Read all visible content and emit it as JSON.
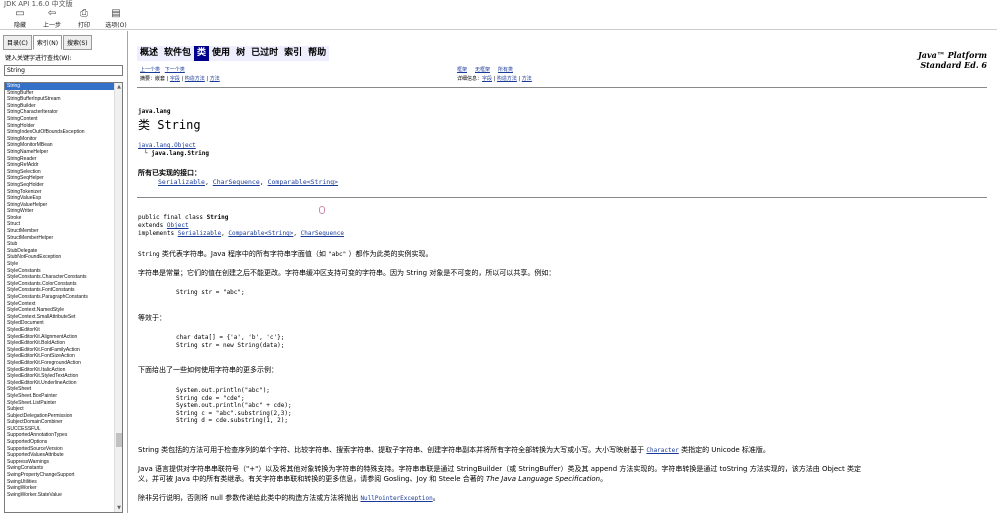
{
  "window": {
    "title": "JDK API 1.6.0 中文版"
  },
  "toolbar": {
    "hide": "隐藏",
    "back": "上一步",
    "print": "打印",
    "options": "选项(O)"
  },
  "tabs": [
    "目录(C)",
    "索引(N)",
    "搜索(S)"
  ],
  "index": {
    "keyword_label": "键入关键字进行查找(W):",
    "keyword_value": "String",
    "items": [
      "String",
      "StringBuffer",
      "StringBufferInputStream",
      "StringBuilder",
      "StringCharacterIterator",
      "StringContent",
      "StringHolder",
      "StringIndexOutOfBoundsException",
      "StringMonitor",
      "StringMonitorMBean",
      "StringNameHelper",
      "StringReader",
      "StringRefAddr",
      "StringSelection",
      "StringSeqHelper",
      "StringSeqHolder",
      "StringTokenizer",
      "StringValueExp",
      "StringValueHelper",
      "StringWriter",
      "Stroke",
      "Struct",
      "StructMember",
      "StructMemberHelper",
      "Stub",
      "StubDelegate",
      "StubNotFoundException",
      "Style",
      "StyleConstants",
      "StyleConstants.CharacterConstants",
      "StyleConstants.ColorConstants",
      "StyleConstants.FontConstants",
      "StyleConstants.ParagraphConstants",
      "StyleContext",
      "StyleContext.NamedStyle",
      "StyleContext.SmallAttributeSet",
      "StyledDocument",
      "StyledEditorKit",
      "StyledEditorKit.AlignmentAction",
      "StyledEditorKit.BoldAction",
      "StyledEditorKit.FontFamilyAction",
      "StyledEditorKit.FontSizeAction",
      "StyledEditorKit.ForegroundAction",
      "StyledEditorKit.ItalicAction",
      "StyledEditorKit.StyledTextAction",
      "StyledEditorKit.UnderlineAction",
      "StyleSheet",
      "StyleSheet.BoxPainter",
      "StyleSheet.ListPainter",
      "Subject",
      "SubjectDelegationPermission",
      "SubjectDomainCombiner",
      "SUCCESSFUL",
      "SupportedAnnotationTypes",
      "SupportedOptions",
      "SupportedSourceVersion",
      "SupportedValuesAttribute",
      "SuppressWarnings",
      "SwingConstants",
      "SwingPropertyChangeSupport",
      "SwingUtilities",
      "SwingWorker",
      "SwingWorker.StateValue"
    ]
  },
  "nav": {
    "items": [
      "概述",
      "软件包",
      "类",
      "使用",
      "树",
      "已过时",
      "索引",
      "帮助"
    ],
    "platform_line1": "Java™ Platform",
    "platform_line2": "Standard Ed. 6",
    "prev_class": "上一个类",
    "next_class": "下一个类",
    "frames": "框架",
    "no_frames": "无框架",
    "all_classes": "所有类",
    "summary_label": "摘要：",
    "summary_nested": "嵌套",
    "detail_label": "详细信息：",
    "field": "字段",
    "constructor": "构造方法",
    "method": "方法",
    "sep": " | "
  },
  "class": {
    "package": "java.lang",
    "title": "类 String",
    "parent": "java.lang.Object",
    "self": "└ java.lang.String",
    "interfaces_heading": "所有已实现的接口：",
    "interfaces": [
      "Serializable",
      "CharSequence",
      "Comparable<String>"
    ],
    "decl_line1": "public final class ",
    "decl_name": "String",
    "decl_extends": "extends ",
    "decl_object": "Object",
    "decl_implements": "implements ",
    "decl_if1": "Serializable",
    "decl_if2": "Comparable<String>",
    "decl_if3": "CharSequence"
  },
  "body": {
    "p1_a": "String",
    "p1_b": " 类代表字符串。Java 程序中的所有字符串字面值（如 ",
    "p1_c": "\"abc\"",
    "p1_d": " ）都作为此类的实例实现。",
    "p2": "字符串是常量；它们的值在创建之后不能更改。字符串缓冲区支持可变的字符串。因为 String 对象是不可变的，所以可以共享。例如：",
    "code1": "String str = \"abc\";",
    "p3": "等效于：",
    "code2": "char data[] = {'a', 'b', 'c'};\nString str = new String(data);",
    "p4": "下面给出了一些如何使用字符串的更多示例：",
    "code3": "System.out.println(\"abc\");\nString cde = \"cde\";\nSystem.out.println(\"abc\" + cde);\nString c = \"abc\".substring(2,3);\nString d = cde.substring(1, 2);",
    "p5_a": "String 类包括的方法可用于检查序列的单个字符、比较字符串、搜索字符串、提取子字符串、创建字符串副本并将所有字符全部转换为大写或小写。大小写映射基于 ",
    "p5_link": "Character",
    "p5_b": " 类指定的 Unicode 标准版。",
    "p6_line1": "Java 语言提供对字符串串联符号（\"+\"）以及将其他对象转换为字符串的特殊支持。字符串串联是通过 StringBuilder（或 StringBuffer）类及其 append 方法实现的。字符串转换是通过 toString 方法实现的，该方法由 Object 类定",
    "p6_line2_a": "义，并可被 Java 中的所有类继承。有关字符串串联和转换的更多信息，请参阅 Gosling、Joy 和 Steele 合著的 ",
    "p6_line2_book": "The Java Language Specification",
    "p6_line2_b": "。",
    "p7_a": "除非另行说明，否则将 null 参数传递给此类中的构造方法或方法将抛出 ",
    "p7_link": "NullPointerException",
    "p7_b": "。"
  }
}
